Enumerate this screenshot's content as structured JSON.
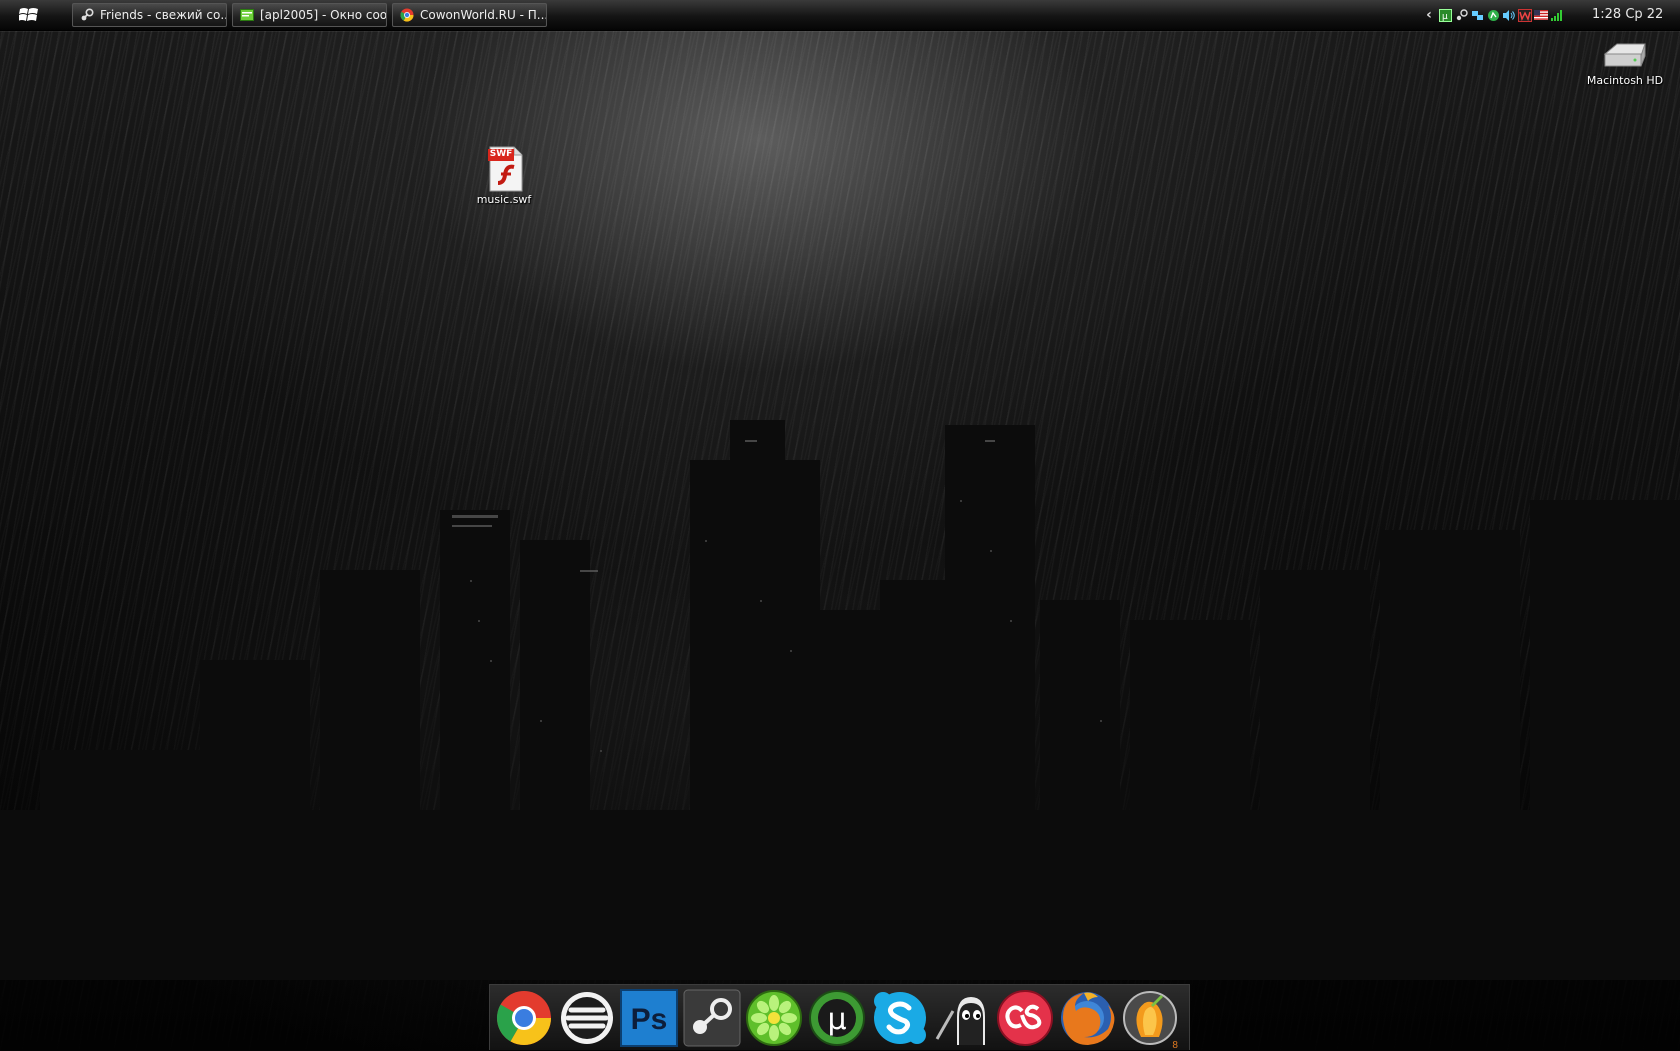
{
  "taskbar": {
    "start_icon": "windows-logo-icon",
    "tasks": [
      {
        "label": "Friends - свежий со...",
        "icon": "steam-icon"
      },
      {
        "label": "[apl2005] - Окно соо...",
        "icon": "chat-window-icon"
      },
      {
        "label": "CowonWorld.RU - П...",
        "icon": "chrome-icon"
      }
    ],
    "tray": {
      "chevron": "‹",
      "icons": [
        "show-hidden-icon",
        "utorrent-tray-icon",
        "steam-tray-icon",
        "network-tray-icon",
        "skype-tray-icon",
        "volume-tray-icon",
        "winamp-tray-icon",
        "language-flag-icon",
        "signal-tray-icon"
      ]
    },
    "clock": "1:28 Ср 22"
  },
  "desktop": {
    "icons": [
      {
        "label": "music.swf",
        "icon": "swf-file-icon",
        "badge": "SWF"
      },
      {
        "label": "Macintosh HD",
        "icon": "hard-drive-icon"
      }
    ]
  },
  "dock": {
    "items": [
      {
        "name": "chrome",
        "icon": "chrome-icon"
      },
      {
        "name": "aimp",
        "icon": "aimp-icon"
      },
      {
        "name": "photoshop",
        "icon": "photoshop-icon",
        "text": "Ps"
      },
      {
        "name": "steam",
        "icon": "steam-icon"
      },
      {
        "name": "icq",
        "icon": "icq-icon"
      },
      {
        "name": "utorrent",
        "icon": "utorrent-icon",
        "text": "µ"
      },
      {
        "name": "skype",
        "icon": "skype-icon"
      },
      {
        "name": "ninja",
        "icon": "ninja-icon"
      },
      {
        "name": "lastfm",
        "icon": "lastfm-icon"
      },
      {
        "name": "firefox",
        "icon": "firefox-icon"
      },
      {
        "name": "fl-studio",
        "icon": "fl-studio-icon",
        "badge": "8"
      }
    ]
  },
  "colors": {
    "taskbar": "#141414",
    "swf_red": "#d9261c",
    "ps_blue": "#1e7fd0",
    "icq_green": "#5fbf2b",
    "skype_blue": "#1aaae5",
    "lastfm_red": "#e4324a"
  }
}
